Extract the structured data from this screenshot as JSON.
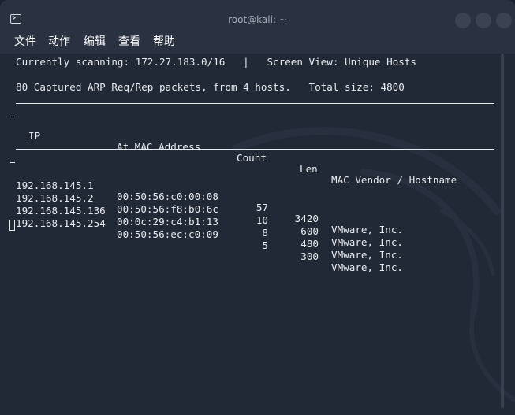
{
  "window": {
    "title": "root@kali: ~"
  },
  "menu": [
    {
      "label": "文件"
    },
    {
      "label": "动作"
    },
    {
      "label": "编辑"
    },
    {
      "label": "查看"
    },
    {
      "label": "帮助"
    }
  ],
  "status": {
    "scanning_line": "Currently scanning: 172.27.183.0/16   |   Screen View: Unique Hosts",
    "summary_line": "80 Captured ARP Req/Rep packets, from 4 hosts.   Total size: 4800"
  },
  "table": {
    "headers": {
      "ip": "IP",
      "mac": "At MAC Address",
      "count": "Count",
      "len": "Len",
      "vendor": "MAC Vendor / Hostname"
    },
    "rows": [
      {
        "ip": "192.168.145.1",
        "mac": "00:50:56:c0:00:08",
        "count": "57",
        "len": "3420",
        "vendor": "VMware, Inc."
      },
      {
        "ip": "192.168.145.2",
        "mac": "00:50:56:f8:b0:6c",
        "count": "10",
        "len": "600",
        "vendor": "VMware, Inc."
      },
      {
        "ip": "192.168.145.136",
        "mac": "00:0c:29:c4:b1:13",
        "count": "8",
        "len": "480",
        "vendor": "VMware, Inc."
      },
      {
        "ip": "192.168.145.254",
        "mac": "00:50:56:ec:c0:09",
        "count": "5",
        "len": "300",
        "vendor": "VMware, Inc."
      }
    ]
  },
  "icons": {
    "app": "terminal-icon",
    "minimize": "minimize-icon",
    "maximize": "maximize-icon",
    "close": "close-icon"
  },
  "colors": {
    "terminal_bg": "#212836",
    "titlebar_bg": "#2a3140",
    "text": "#e8ebef"
  }
}
